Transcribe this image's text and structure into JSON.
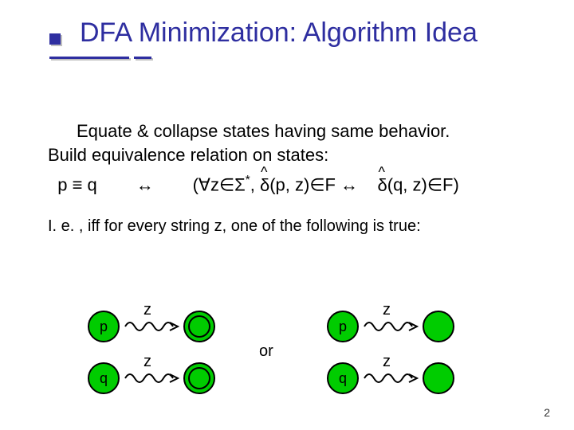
{
  "title": "DFA Minimization: Algorithm Idea",
  "body": {
    "line1": "Equate & collapse states having same behavior.",
    "line2": "Build equivalence relation on states:"
  },
  "equation": {
    "lhs": "p ≡ q",
    "iff": "↔",
    "rhs_open": "(∀z∈Σ",
    "star": "*",
    "rhs_mid1": ", ",
    "delta": "δ",
    "rhs_p": "(p, z)∈F ",
    "rhs_iff2": "↔",
    "rhs_q": "(q, z)∈F)"
  },
  "ie": "I. e. , iff for every string z, one of the following is true:",
  "diagram": {
    "p": "p",
    "q": "q",
    "z": "z",
    "or": "or"
  },
  "page": "2"
}
